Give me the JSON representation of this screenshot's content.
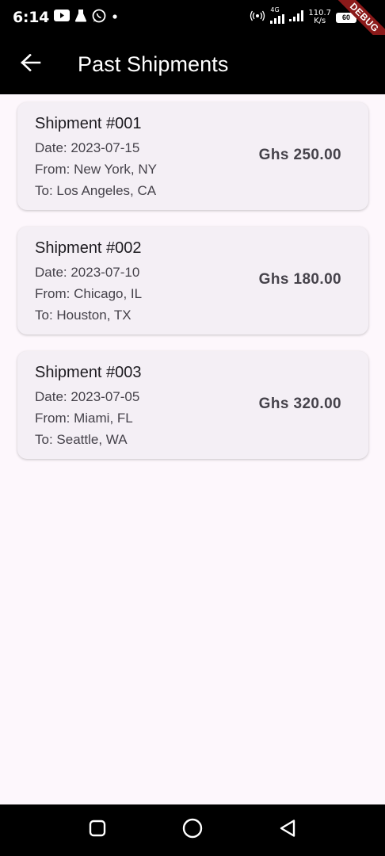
{
  "status_bar": {
    "time": "6:14",
    "network_type": "4G",
    "speed_value": "110.7",
    "speed_unit": "K/s",
    "battery": "60",
    "debug_label": "DEBUG"
  },
  "app_bar": {
    "title": "Past Shipments",
    "back_icon": "arrow-left-icon"
  },
  "shipments": [
    {
      "title": "Shipment #001",
      "date": "Date: 2023-07-15",
      "from": "From: New York, NY",
      "to": "To: Los Angeles, CA",
      "amount": "Ghs 250.00"
    },
    {
      "title": "Shipment #002",
      "date": "Date: 2023-07-10",
      "from": "From: Chicago, IL",
      "to": "To: Houston, TX",
      "amount": "Ghs 180.00"
    },
    {
      "title": "Shipment #003",
      "date": "Date: 2023-07-05",
      "from": "From: Miami, FL",
      "to": "To: Seattle, WA",
      "amount": "Ghs 320.00"
    }
  ],
  "nav_bar": {
    "icons": [
      "recents-square-icon",
      "home-circle-icon",
      "back-triangle-icon"
    ]
  },
  "colors": {
    "background": "#fdf7fc",
    "app_bar": "#000000",
    "card": "#f4eff5",
    "text_primary": "#1d1b20",
    "text_secondary": "#45424a"
  }
}
